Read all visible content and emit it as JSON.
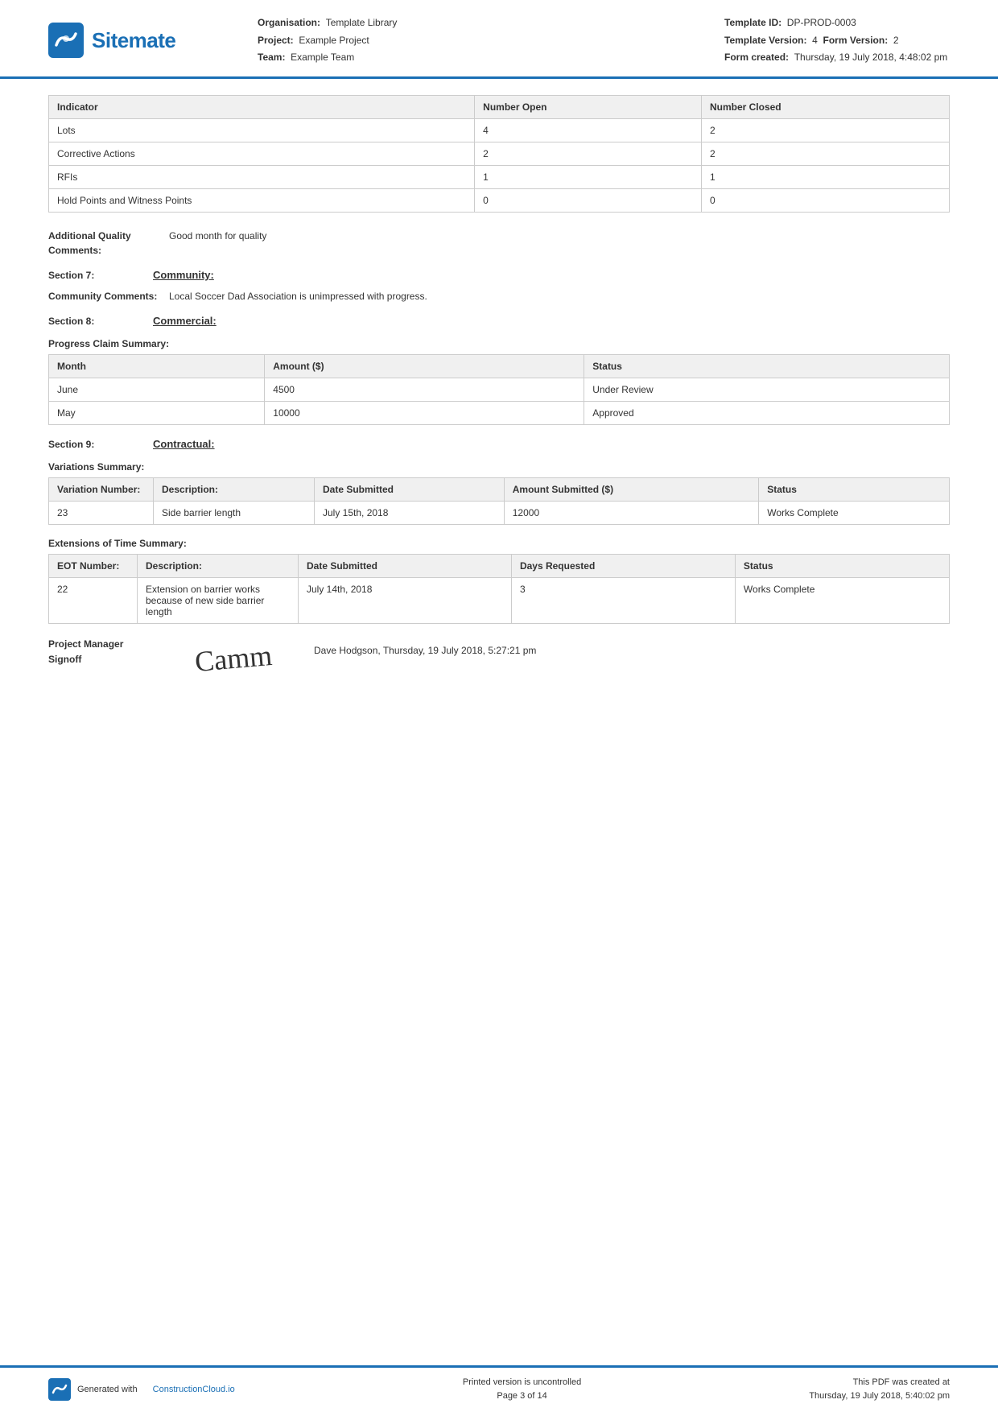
{
  "header": {
    "logo_text": "Sitemate",
    "org_label": "Organisation:",
    "org_value": "Template Library",
    "project_label": "Project:",
    "project_value": "Example Project",
    "team_label": "Team:",
    "team_value": "Example Team",
    "template_id_label": "Template ID:",
    "template_id_value": "DP-PROD-0003",
    "template_version_label": "Template Version:",
    "template_version_value": "4",
    "form_version_label": "Form Version:",
    "form_version_value": "2",
    "form_created_label": "Form created:",
    "form_created_value": "Thursday, 19 July 2018, 4:48:02 pm"
  },
  "indicator_table": {
    "col_indicator": "Indicator",
    "col_number_open": "Number Open",
    "col_number_closed": "Number Closed",
    "rows": [
      {
        "indicator": "Lots",
        "open": "4",
        "closed": "2"
      },
      {
        "indicator": "Corrective Actions",
        "open": "2",
        "closed": "2"
      },
      {
        "indicator": "RFIs",
        "open": "1",
        "closed": "1"
      },
      {
        "indicator": "Hold Points and Witness Points",
        "open": "0",
        "closed": "0"
      }
    ]
  },
  "additional_quality": {
    "label": "Additional Quality Comments:",
    "value": "Good month for quality"
  },
  "section7": {
    "num": "Section 7:",
    "title": "Community:"
  },
  "community_comments": {
    "label": "Community Comments:",
    "value": "Local Soccer Dad Association is unimpressed with progress."
  },
  "section8": {
    "num": "Section 8:",
    "title": "Commercial:"
  },
  "progress_claim": {
    "title": "Progress Claim Summary:",
    "col_month": "Month",
    "col_amount": "Amount ($)",
    "col_status": "Status",
    "rows": [
      {
        "month": "June",
        "amount": "4500",
        "status": "Under Review"
      },
      {
        "month": "May",
        "amount": "10000",
        "status": "Approved"
      }
    ]
  },
  "section9": {
    "num": "Section 9:",
    "title": "Contractual:"
  },
  "variations": {
    "title": "Variations Summary:",
    "col_variation_number": "Variation Number:",
    "col_description": "Description:",
    "col_date_submitted": "Date Submitted",
    "col_amount_submitted": "Amount Submitted ($)",
    "col_status": "Status",
    "rows": [
      {
        "number": "23",
        "description": "Side barrier length",
        "date_submitted": "July 15th, 2018",
        "amount_submitted": "12000",
        "status": "Works Complete"
      }
    ]
  },
  "eot": {
    "title": "Extensions of Time Summary:",
    "col_eot_number": "EOT Number:",
    "col_description": "Description:",
    "col_date_submitted": "Date Submitted",
    "col_days_requested": "Days Requested",
    "col_status": "Status",
    "rows": [
      {
        "number": "22",
        "description": "Extension on barrier works because of new side barrier length",
        "date_submitted": "July 14th, 2018",
        "days_requested": "3",
        "status": "Works Complete"
      }
    ]
  },
  "project_manager": {
    "label": "Project Manager Signoff",
    "signoff_text": "Dave Hodgson, Thursday, 19 July 2018, 5:27:21 pm",
    "signature_display": "Camm"
  },
  "footer": {
    "generated_text": "Generated with",
    "generated_link": "ConstructionCloud.io",
    "uncontrolled_line1": "Printed version is uncontrolled",
    "uncontrolled_line2": "Page 3 of 14",
    "pdf_created_line1": "This PDF was created at",
    "pdf_created_line2": "Thursday, 19 July 2018, 5:40:02 pm"
  }
}
